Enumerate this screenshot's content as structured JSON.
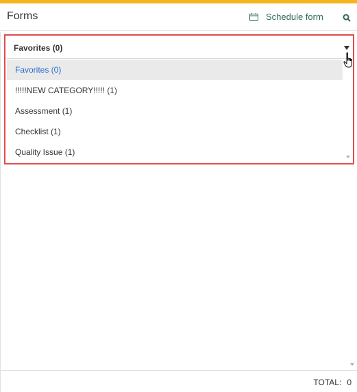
{
  "header": {
    "title": "Forms",
    "schedule_label": "Schedule form",
    "icons": {
      "schedule": "calendar-icon",
      "search": "search-icon"
    }
  },
  "dropdown": {
    "selected": "Favorites (0)",
    "options": [
      "Favorites (0)",
      "!!!!!NEW CATEGORY!!!!! (1)",
      "Assessment (1)",
      "Checklist (1)",
      "Quality Issue (1)"
    ]
  },
  "footer": {
    "total_label": "TOTAL:",
    "total_value": "0"
  },
  "colors": {
    "top_accent": "#f5b51d",
    "highlight_border": "#e24b4b",
    "selected_option_text": "#2a6fc9",
    "schedule_text": "#2f6b52"
  }
}
